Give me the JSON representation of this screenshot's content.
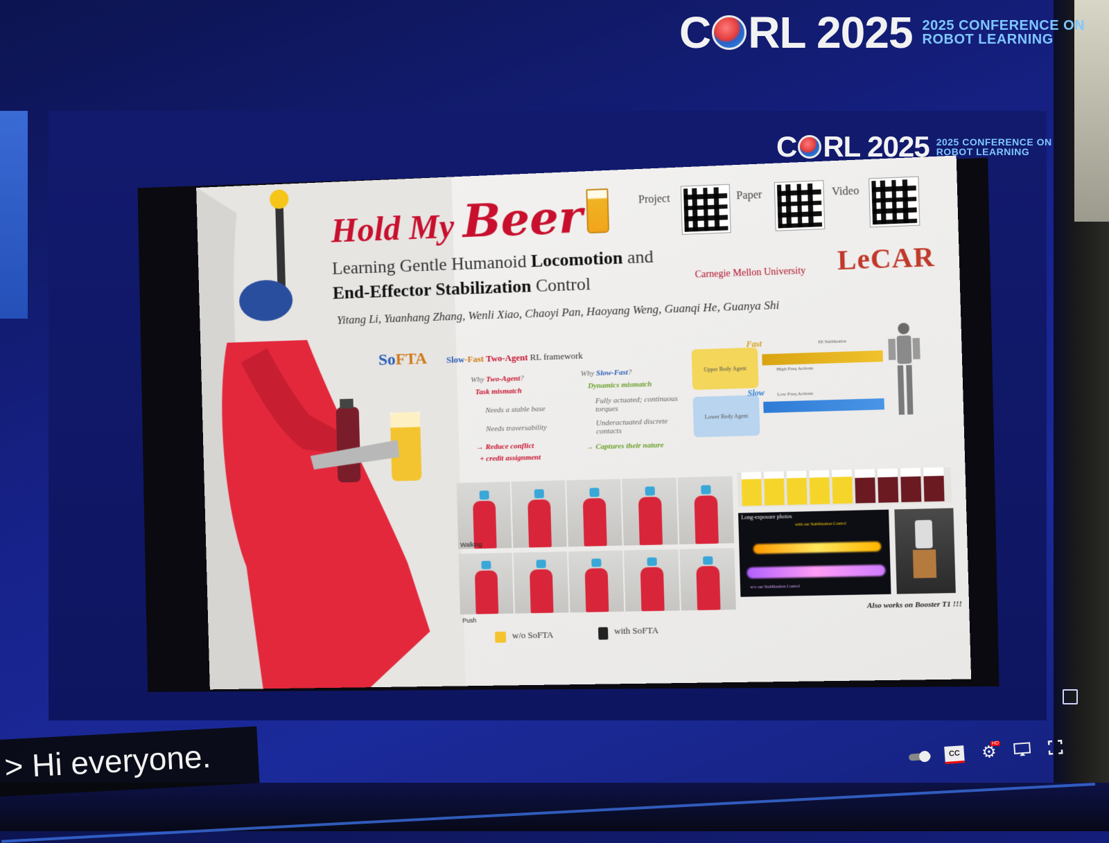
{
  "brand": {
    "logo_text": "CORL 2025",
    "logo_c": "C",
    "logo_rest": "RL 2025",
    "tag_line1": "2025 CONFERENCE ON",
    "tag_line2": "ROBOT LEARNING"
  },
  "slide": {
    "title_part1": "Hold My ",
    "title_part2": "Beer",
    "qr_labels": [
      "Project",
      "Paper",
      "Video"
    ],
    "subtitle_line1_a": "Learning Gentle Humanoid ",
    "subtitle_line1_b": "Locomotion",
    "subtitle_line1_c": " and",
    "subtitle_line2_a": "End-Effector Stabilization",
    "subtitle_line2_b": " Control",
    "institution": "Carnegie Mellon University",
    "lab_logo": "LeCAR",
    "authors": "Yitang Li, Yuanhang Zhang, Wenli Xiao, Chaoyi Pan, Haoyang Weng, Guanqi He, Guanya Shi",
    "framework_name_a": "So",
    "framework_name_b": "FTA",
    "framework_desc_slow": "Slow",
    "framework_desc_fast": "-Fast",
    "framework_desc_two": " Two-Agent",
    "framework_desc_rest": " RL framework",
    "why_two_agent": {
      "heading": "Two-Agent",
      "point": "Task mismatch",
      "item1": "Needs a stable base",
      "item2": "Needs traversability",
      "result1": "→ Reduce conflict",
      "result2": "+ credit assignment"
    },
    "why_slow_fast": {
      "heading": "Slow-Fast",
      "point": "Dynamics mismatch",
      "item1": "Fully actuated; continuous torques",
      "item2": "Underactuated discrete contacts",
      "result": "→ Captures their nature"
    },
    "diagram": {
      "fast_label": "Fast",
      "slow_label": "Slow",
      "upper_agent": "Upper Body Agent",
      "lower_agent": "Lower Body Agent",
      "high_freq": "High Freq Actions",
      "low_freq": "Low Freq Actions",
      "ee_label": "EE Stabilization"
    },
    "row_labels": [
      "Walking",
      "Push"
    ],
    "long_exposure_label": "Long-exposure photos",
    "with_control": "with our Stabilization Control",
    "without_control": "w/o our Stabilization Control",
    "booster_note": "Also works on Booster T1 !!!",
    "legend_without": "w/o SoFTA",
    "legend_with": "with SoFTA"
  },
  "captions": {
    "prefix": ">",
    "text": "Hi everyone."
  },
  "player": {
    "cc_label": "CC",
    "settings_badge": "HD"
  },
  "colors": {
    "title_red": "#c8102e",
    "accent_blue": "#2b5db8",
    "tag_cyan": "#7ec7ff",
    "background_blue": "#17228a"
  }
}
